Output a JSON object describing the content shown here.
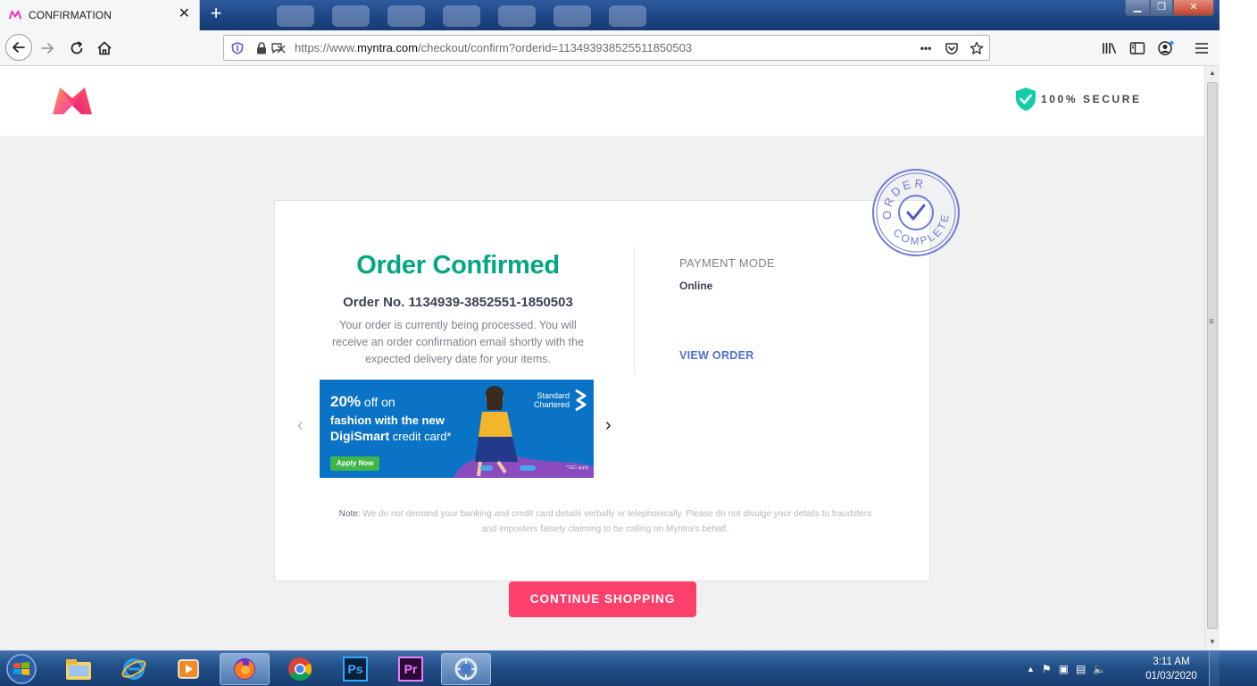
{
  "browser": {
    "tab_title": "CONFIRMATION",
    "tab_close": "✕",
    "new_tab": "+",
    "url_prefix": "https://www.",
    "url_domain": "myntra.com",
    "url_path": "/checkout/confirm?orderid=113493938525511850503",
    "more": "•••"
  },
  "header": {
    "secure_label": "100% SECURE"
  },
  "order": {
    "title": "Order Confirmed",
    "number": "Order No. 1134939-3852551-1850503",
    "description": "Your order is currently being processed. You will receive an order confirmation email shortly with the expected delivery date for your items.",
    "payment_label": "PAYMENT MODE",
    "payment_value": "Online",
    "view_order": "VIEW ORDER"
  },
  "banner": {
    "line1": "20%",
    "line1b": " off on",
    "line2": "fashion with the new",
    "line3": "DigiSmart",
    "line3b": " credit card*",
    "cta": "Apply Now",
    "bank_line1": "Standard",
    "bank_line2": "Chartered",
    "tc": "*T&C apply"
  },
  "note": {
    "label": "Note:",
    "text": " We do not demand your banking and credit card details verbally or telephonically. Please do not divulge your details to fraudsters and imposters falsely claiming to be calling on Myntra's behalf."
  },
  "stamp": {
    "top": "ORDER",
    "bottom": "COMPLETE"
  },
  "cta": {
    "continue_shopping": "CONTINUE SHOPPING"
  },
  "taskbar": {
    "time": "3:11 AM",
    "date": "01/03/2020",
    "apps": [
      "file-explorer",
      "internet-explorer",
      "media-player",
      "firefox",
      "chrome",
      "photoshop",
      "premiere",
      "network-app"
    ],
    "ps_label": "Ps",
    "pr_label": "Pr"
  },
  "colors": {
    "brand_pink": "#ff3f6c",
    "success_green": "#03a685",
    "link_blue": "#526cd0",
    "stamp_blue": "#6f7bd8"
  }
}
